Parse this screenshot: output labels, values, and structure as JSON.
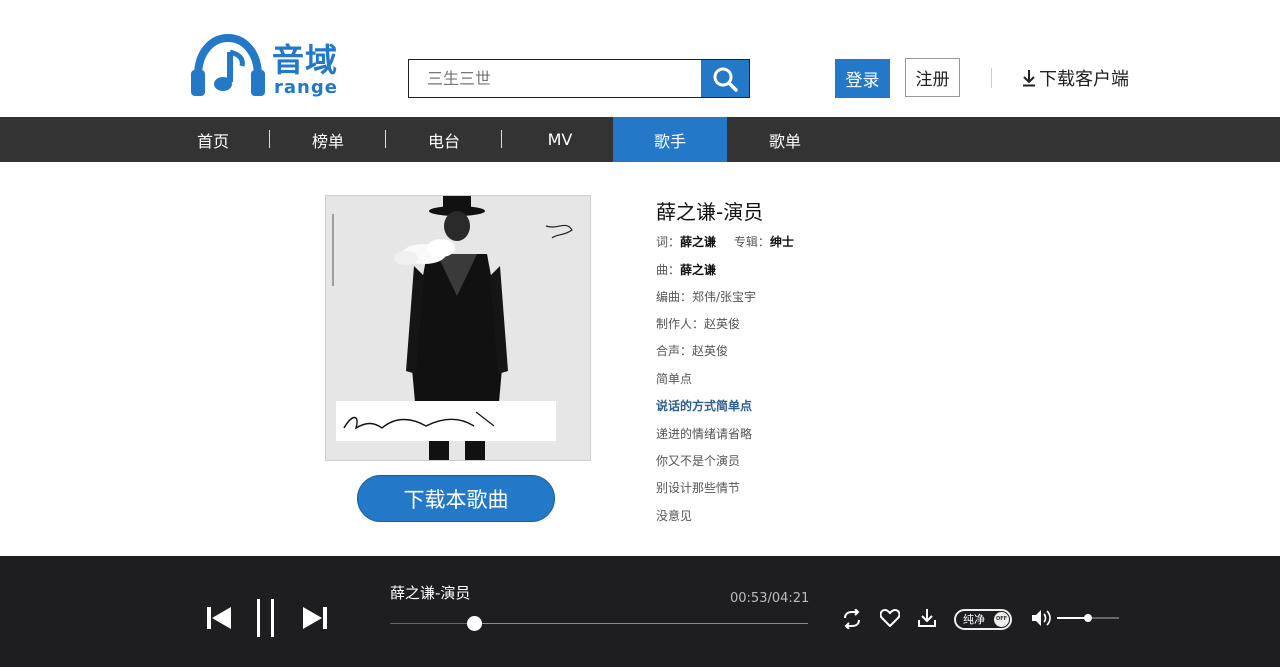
{
  "brand": {
    "name": "音域",
    "subtitle": "range",
    "accent_color": "#2378c8"
  },
  "search": {
    "value": "",
    "placeholder": "三生三世",
    "icon": "search-icon"
  },
  "header": {
    "login_label": "登录",
    "register_label": "注册",
    "download_client_label": "下载客户端",
    "download_icon": "download-icon"
  },
  "nav": {
    "items": [
      {
        "label": "首页"
      },
      {
        "label": "榜单"
      },
      {
        "label": "电台"
      },
      {
        "label": "MV"
      },
      {
        "label": "歌手",
        "active": true
      },
      {
        "label": "歌单"
      }
    ]
  },
  "cover": {
    "art_text": "Gentleman",
    "art_subtext": "绅士",
    "art_side_text": "薛 之 谦"
  },
  "song": {
    "title": "薛之谦-演员",
    "lyricist_label": "词：",
    "lyricist": "薛之谦",
    "album_label": "专辑：",
    "album": "绅士",
    "composer_label": "曲：",
    "composer": "薛之谦",
    "arranger": "编曲：郑伟/张宝宇",
    "producer": "制作人：赵英俊",
    "backing_vocals": "合声：赵英俊",
    "download_label": "下载本歌曲"
  },
  "lyrics": [
    {
      "text": "简单点",
      "current": false
    },
    {
      "text": "说话的方式简单点",
      "current": true
    },
    {
      "text": "递进的情绪请省略",
      "current": false
    },
    {
      "text": "你又不是个演员",
      "current": false
    },
    {
      "text": "别设计那些情节",
      "current": false
    },
    {
      "text": "没意见",
      "current": false
    }
  ],
  "player": {
    "now_playing": "薛之谦-演员",
    "elapsed": "00:53",
    "duration": "04:21",
    "time_display": "00:53/04:21",
    "progress_fraction": 0.2,
    "volume_fraction": 0.5,
    "pure_mode_label": "纯净",
    "pure_mode_state": "OFF",
    "icons": [
      "previous-icon",
      "pause-icon",
      "next-icon",
      "loop-icon",
      "heart-icon",
      "download-icon",
      "volume-icon"
    ]
  }
}
